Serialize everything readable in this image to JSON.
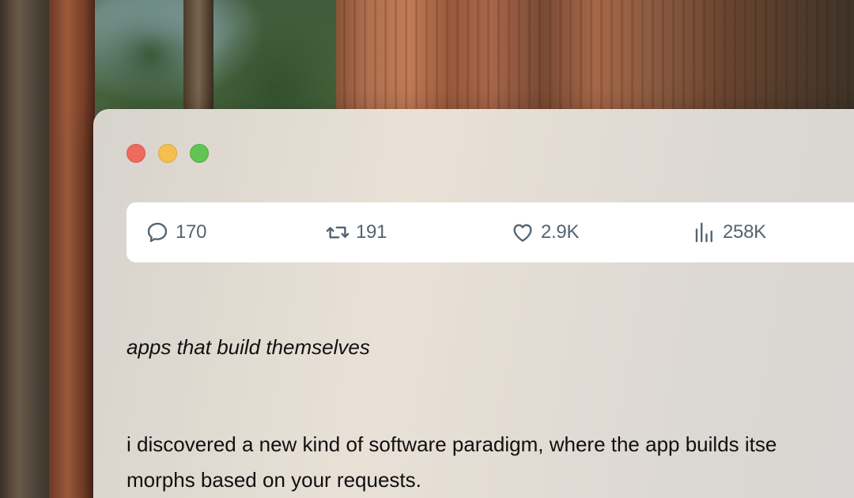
{
  "window": {
    "controls": {
      "close_color": "#ee6a5f",
      "minimize_color": "#f5bf4f",
      "zoom_color": "#61c454"
    }
  },
  "actions": [
    {
      "icon": "reply-icon",
      "count": "170"
    },
    {
      "icon": "retweet-icon",
      "count": "191"
    },
    {
      "icon": "like-icon",
      "count": "2.9K"
    },
    {
      "icon": "views-icon",
      "count": "258K"
    }
  ],
  "post": {
    "headline": "apps that build themselves",
    "body_lines": [
      "i discovered a new kind of software paradigm, where the app builds itse",
      "morphs based on your requests."
    ]
  },
  "colors": {
    "action_text": "#536471",
    "body_text": "#101010",
    "action_bar_bg": "#ffffff"
  }
}
